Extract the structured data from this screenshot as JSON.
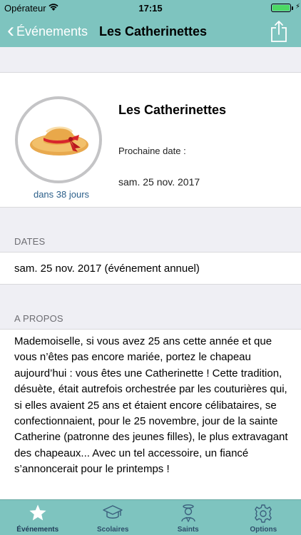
{
  "status_bar": {
    "carrier": "Opérateur",
    "time": "17:15"
  },
  "navbar": {
    "back_label": "Événements",
    "title": "Les Catherinettes"
  },
  "event": {
    "title": "Les Catherinettes",
    "countdown": "dans 38 jours",
    "next_label": "Prochaine date :",
    "next_date": "sam. 25 nov. 2017"
  },
  "dates": {
    "header": "DATES",
    "items": [
      "sam. 25 nov. 2017 (événement annuel)"
    ]
  },
  "about": {
    "header": "A PROPOS",
    "text": "Mademoiselle, si vous avez 25 ans cette année et que vous n’êtes pas encore mariée, portez le chapeau aujourd’hui : vous êtes une Catherinette ! Cette tradition, désuète, était autrefois orchestrée par les couturières qui, si elles avaient 25 ans et étaient encore célibataires, se confectionnaient, pour le 25 novembre, jour de la sainte Catherine (patronne des jeunes filles), le plus extravagant des chapeaux... Avec un tel accessoire, un fiancé s’annoncerait pour le printemps !"
  },
  "tabs": [
    {
      "label": "Événements",
      "icon": "star-icon",
      "active": true
    },
    {
      "label": "Scolaires",
      "icon": "graduation-cap-icon",
      "active": false
    },
    {
      "label": "Saints",
      "icon": "saint-icon",
      "active": false
    },
    {
      "label": "Options",
      "icon": "gear-icon",
      "active": false
    }
  ],
  "colors": {
    "bar": "#7ec4bf",
    "link": "#2c5f8a",
    "battery": "#4cd964"
  }
}
